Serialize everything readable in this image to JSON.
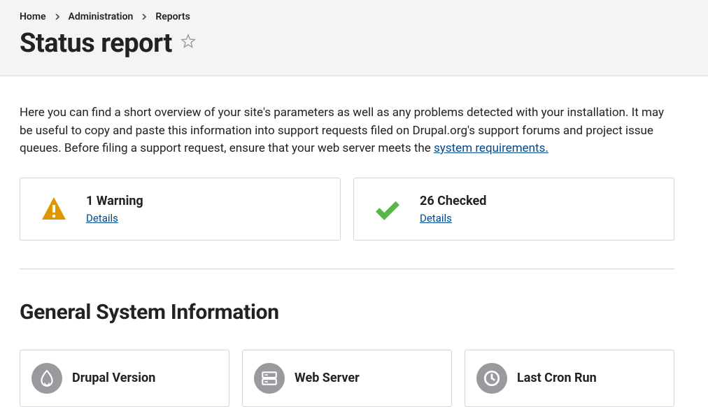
{
  "breadcrumb": {
    "home": "Home",
    "administration": "Administration",
    "reports": "Reports"
  },
  "page": {
    "title": "Status report"
  },
  "intro": {
    "text_before_link": "Here you can find a short overview of your site's parameters as well as any problems detected with your installation. It may be useful to copy and paste this information into support requests filed on Drupal.org's support forums and project issue queues. Before filing a support request, ensure that your web server meets the ",
    "link_text": "system requirements."
  },
  "status_cards": {
    "warning": {
      "title": "1 Warning",
      "link": "Details"
    },
    "checked": {
      "title": "26 Checked",
      "link": "Details"
    }
  },
  "section": {
    "heading": "General System Information"
  },
  "info_cards": {
    "drupal": {
      "title": "Drupal Version"
    },
    "web": {
      "title": "Web Server"
    },
    "cron": {
      "title": "Last Cron Run"
    }
  }
}
